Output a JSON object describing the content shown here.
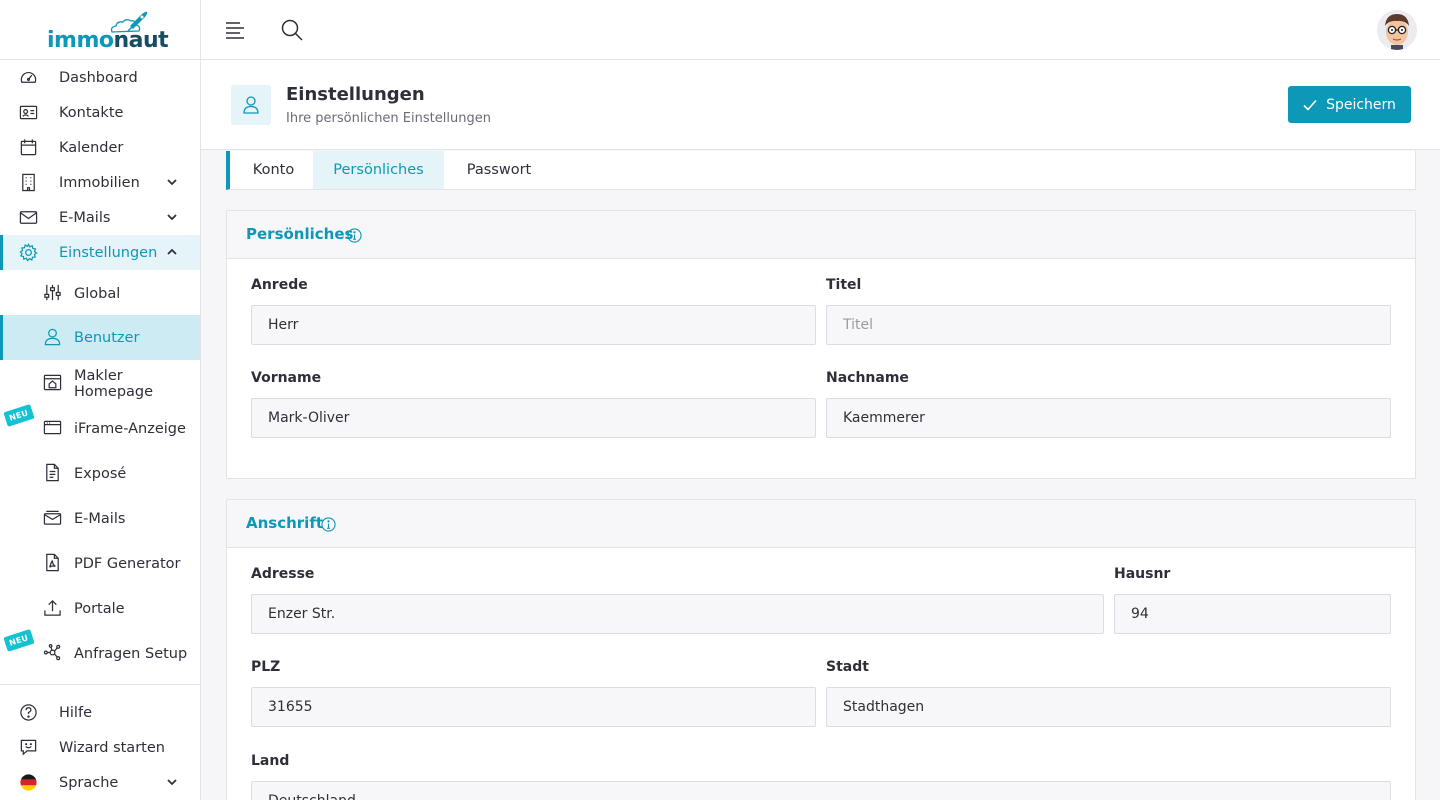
{
  "app": {
    "logo": {
      "part1": "immo",
      "part2": "naut"
    }
  },
  "sidebar": {
    "items": [
      {
        "label": "Dashboard"
      },
      {
        "label": "Kontakte"
      },
      {
        "label": "Kalender"
      },
      {
        "label": "Immobilien"
      },
      {
        "label": "E-Mails"
      },
      {
        "label": "Einstellungen"
      }
    ],
    "sub_items": [
      {
        "label": "Global"
      },
      {
        "label": "Benutzer"
      },
      {
        "label": "Makler Homepage"
      },
      {
        "label": "iFrame-Anzeige",
        "badge": "NEU"
      },
      {
        "label": "Exposé"
      },
      {
        "label": "E-Mails"
      },
      {
        "label": "PDF Generator"
      },
      {
        "label": "Portale"
      },
      {
        "label": "Anfragen Setup",
        "badge": "NEU"
      }
    ],
    "footer_items": [
      {
        "label": "Hilfe"
      },
      {
        "label": "Wizard starten"
      },
      {
        "label": "Sprache"
      }
    ]
  },
  "page": {
    "title": "Einstellungen",
    "subtitle": "Ihre persönlichen Einstellungen",
    "save_label": "Speichern"
  },
  "tabs": [
    {
      "label": "Konto"
    },
    {
      "label": "Persönliches"
    },
    {
      "label": "Passwort"
    }
  ],
  "personal": {
    "title": "Persönliches",
    "fields": {
      "anrede": {
        "label": "Anrede",
        "value": "Herr"
      },
      "titel": {
        "label": "Titel",
        "value": "",
        "placeholder": "Titel"
      },
      "vorname": {
        "label": "Vorname",
        "value": "Mark-Oliver"
      },
      "nachname": {
        "label": "Nachname",
        "value": "Kaemmerer"
      }
    }
  },
  "address": {
    "title": "Anschrift",
    "fields": {
      "adresse": {
        "label": "Adresse",
        "value": "Enzer Str."
      },
      "hausnr": {
        "label": "Hausnr",
        "value": "94"
      },
      "plz": {
        "label": "PLZ",
        "value": "31655"
      },
      "stadt": {
        "label": "Stadt",
        "value": "Stadthagen"
      },
      "land": {
        "label": "Land",
        "value": "Deutschland"
      }
    }
  },
  "colors": {
    "accent": "#0c98b6",
    "accent_light": "#e5f4f8",
    "badge": "#14c2d4"
  }
}
